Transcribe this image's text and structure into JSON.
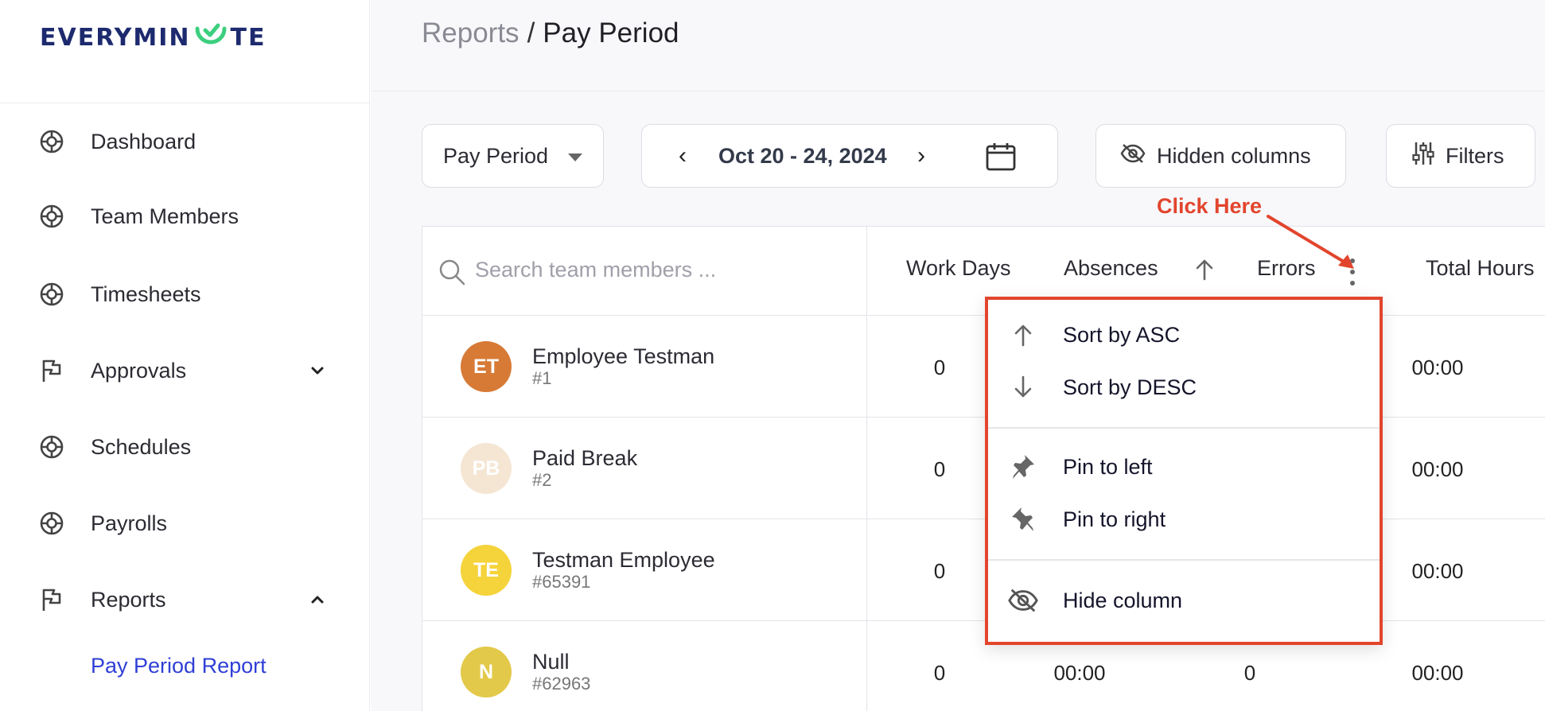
{
  "logo": {
    "text_before": "EVERYMIN",
    "text_after": "TE"
  },
  "sidebar": {
    "items": [
      {
        "label": "Dashboard",
        "icon": "lifebuoy-icon"
      },
      {
        "label": "Team Members",
        "icon": "lifebuoy-icon"
      },
      {
        "label": "Timesheets",
        "icon": "lifebuoy-icon"
      },
      {
        "label": "Approvals",
        "icon": "flag-icon",
        "expanded": false
      },
      {
        "label": "Schedules",
        "icon": "lifebuoy-icon"
      },
      {
        "label": "Payrolls",
        "icon": "lifebuoy-icon"
      },
      {
        "label": "Reports",
        "icon": "flag-icon",
        "expanded": true
      }
    ],
    "sub_items": [
      {
        "label": "Pay Period Report",
        "active": true
      }
    ]
  },
  "header": {
    "breadcrumb_parent": "Reports",
    "breadcrumb_sep": "/",
    "breadcrumb_current": "Pay Period"
  },
  "toolbar": {
    "period_select": "Pay Period",
    "prev_symbol": "‹",
    "next_symbol": "›",
    "date_range": "Oct 20 - 24, 2024",
    "hidden_columns_label": "Hidden columns",
    "filters_label": "Filters"
  },
  "table": {
    "search_placeholder": "Search team members ...",
    "columns": {
      "work_days": "Work Days",
      "absences": "Absences",
      "errors": "Errors",
      "total_hours": "Total Hours"
    },
    "rows": [
      {
        "initials": "ET",
        "name": "Employee Testman",
        "id": "#1",
        "avatar_color": "#d77a36",
        "work_days": "0",
        "absences": "",
        "errors": "",
        "total_hours": "00:00"
      },
      {
        "initials": "PB",
        "name": "Paid Break",
        "id": "#2",
        "avatar_color": "#f5e6d3",
        "work_days": "0",
        "absences": "",
        "errors": "",
        "total_hours": "00:00"
      },
      {
        "initials": "TE",
        "name": "Testman Employee",
        "id": "#65391",
        "avatar_color": "#f5d33a",
        "work_days": "0",
        "absences": "",
        "errors": "",
        "total_hours": "00:00"
      },
      {
        "initials": "N",
        "name": "Null",
        "id": "#62963",
        "avatar_color": "#e3c94a",
        "work_days": "0",
        "absences": "00:00",
        "errors": "0",
        "total_hours": "00:00"
      }
    ]
  },
  "column_menu": {
    "sort_asc": "Sort by ASC",
    "sort_desc": "Sort by DESC",
    "pin_left": "Pin to left",
    "pin_right": "Pin to right",
    "hide_column": "Hide column"
  },
  "annotation": {
    "text": "Click Here",
    "color": "#e2452d"
  },
  "colors": {
    "accent": "#2f3fd6",
    "brand_navy": "#1d2a6e",
    "brand_green": "#3ccf7e",
    "annotation_red": "#e2452d"
  }
}
